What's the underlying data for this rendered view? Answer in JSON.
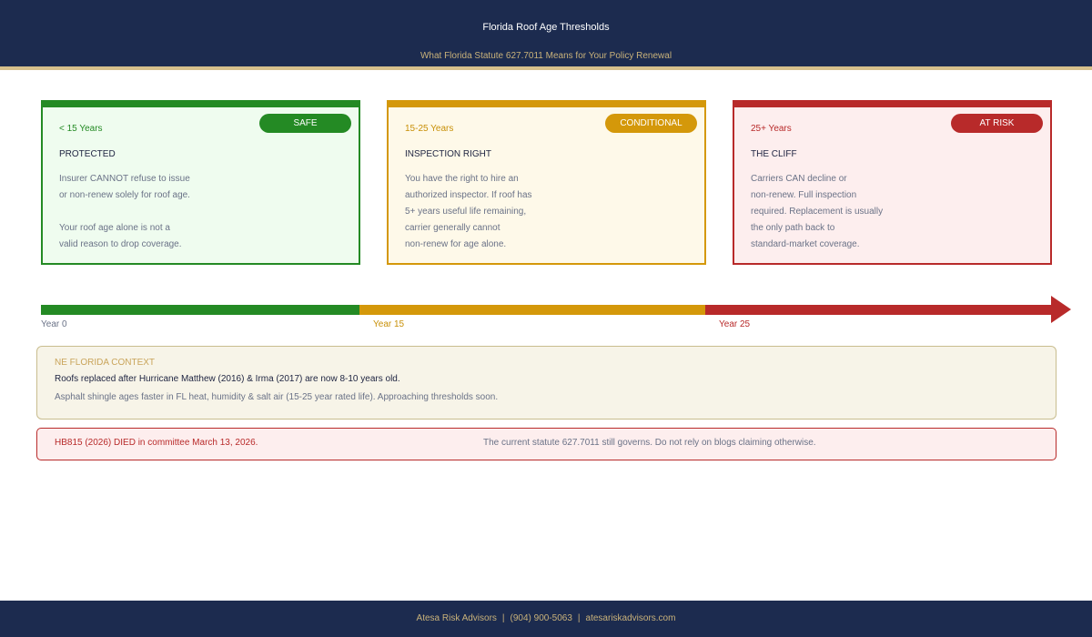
{
  "header": {
    "title": "Florida Roof Age Thresholds",
    "subtitle": "What Florida Statute 627.7011 Means for Your Policy Renewal"
  },
  "cards": [
    {
      "range": "< 15 Years",
      "badge": "SAFE",
      "heading": "PROTECTED",
      "body": [
        "Insurer CANNOT refuse to issue",
        "or non-renew solely for roof age.",
        "",
        "Your roof age alone is not a",
        "valid reason to drop coverage."
      ]
    },
    {
      "range": "15-25 Years",
      "badge": "CONDITIONAL",
      "heading": "INSPECTION RIGHT",
      "body": [
        "You have the right to hire an",
        "authorized inspector. If roof has",
        "5+ years useful life remaining,",
        "carrier generally cannot",
        "non-renew for age alone."
      ]
    },
    {
      "range": "25+ Years",
      "badge": "AT RISK",
      "heading": "THE CLIFF",
      "body": [
        "Carriers CAN decline or",
        "non-renew. Full inspection",
        "required. Replacement is usually",
        "the only path back to",
        "standard-market coverage."
      ]
    }
  ],
  "timeline": {
    "ticks": [
      "Year 0",
      "Year 15",
      "Year 25"
    ]
  },
  "context": {
    "label": "NE FLORIDA CONTEXT",
    "main": "Roofs replaced after Hurricane Matthew (2016) & Irma (2017) are now 8-10 years old.",
    "sub": "Asphalt shingle ages faster in FL heat, humidity & salt air (15-25 year rated life). Approaching thresholds soon."
  },
  "alert": {
    "left": "HB815 (2026) DIED in committee March 13, 2026.",
    "right": "The current statute 627.7011 still governs. Do not rely on blogs claiming otherwise."
  },
  "footer": {
    "company": "Atesa Risk Advisors",
    "separator": "|",
    "phone": "(904) 900-5063",
    "website": "atesariskadvisors.com"
  },
  "colors": {
    "navy": "#1c2b4f",
    "gold": "#c9b27a",
    "safe": "#248a24",
    "conditional": "#d4980a",
    "at_risk": "#b82a2a"
  }
}
